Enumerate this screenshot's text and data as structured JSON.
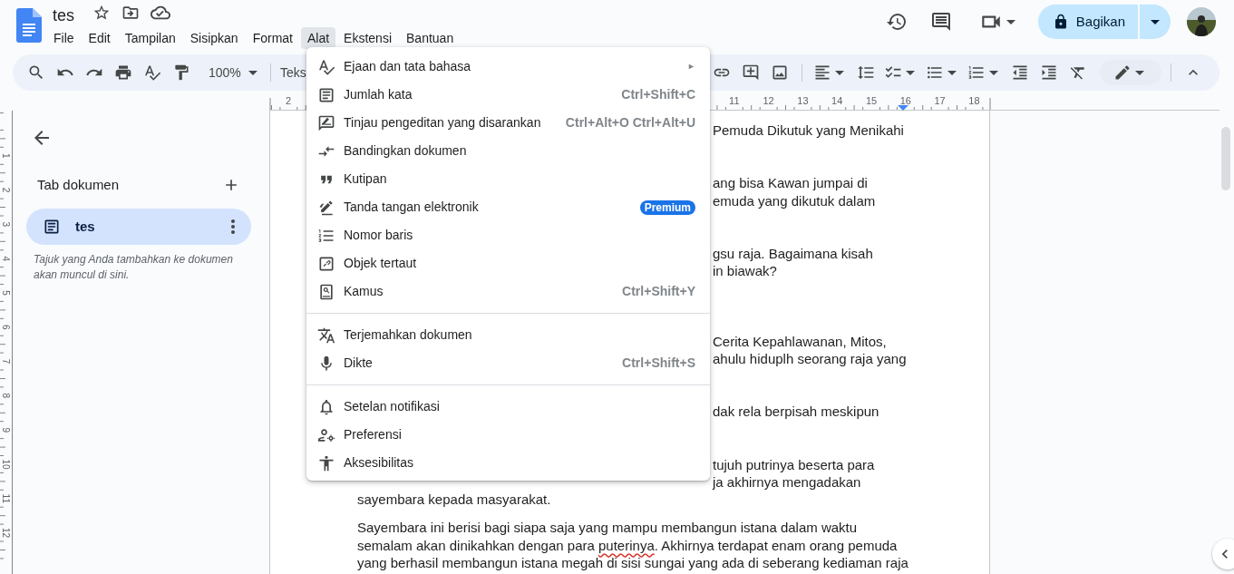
{
  "document": {
    "title": "tes"
  },
  "menubar": [
    {
      "label": "File",
      "selected": false
    },
    {
      "label": "Edit",
      "selected": false
    },
    {
      "label": "Tampilan",
      "selected": false
    },
    {
      "label": "Sisipkan",
      "selected": false
    },
    {
      "label": "Format",
      "selected": false
    },
    {
      "label": "Alat",
      "selected": true
    },
    {
      "label": "Ekstensi",
      "selected": false
    },
    {
      "label": "Bantuan",
      "selected": false
    }
  ],
  "share_button": {
    "label": "Bagikan"
  },
  "toolbar": {
    "zoom": "100%",
    "style": "Teks"
  },
  "ruler": {
    "labels": [
      "2",
      "11",
      "12",
      "13",
      "14",
      "15",
      "16",
      "17",
      "18"
    ]
  },
  "vertical_ruler": {
    "labels": [
      "1",
      "2",
      "3",
      "4",
      "5",
      "6",
      "7",
      "8",
      "9",
      "10",
      "11",
      "12"
    ]
  },
  "sidebar": {
    "heading": "Tab dokumen",
    "tabs": [
      {
        "label": "tes",
        "selected": true
      }
    ],
    "hint": "Tajuk yang Anda tambahkan ke dokumen akan muncul di sini."
  },
  "page": {
    "paragraphs": [
      {
        "lines": [
          {
            "kind": "covered",
            "text": "Pemuda Dikutuk yang Menikahi"
          }
        ]
      },
      {
        "lines": [
          {
            "kind": "covered",
            "text": "ang bisa Kawan jumpai di"
          },
          {
            "kind": "covered",
            "text": "emuda yang dikutuk dalam"
          }
        ]
      },
      {
        "lines": [
          {
            "kind": "covered",
            "text": "gsu raja. Bagaimana kisah"
          },
          {
            "kind": "covered",
            "text": "in biawak?"
          }
        ]
      },
      {
        "lines": [
          {
            "kind": "covered",
            "text": "Cerita Kepahlawanan, Mitos,"
          },
          {
            "kind": "covered",
            "text": "ahulu hiduplh seorang raja yang"
          }
        ]
      },
      {
        "lines": [
          {
            "kind": "covered",
            "text": "dak rela berpisah meskipun"
          }
        ]
      },
      {
        "lines": [
          {
            "kind": "covered",
            "text": "tujuh putrinya beserta para"
          },
          {
            "kind": "covered",
            "text": "ja akhirnya mengadakan"
          },
          {
            "kind": "full",
            "text": "sayembara kepada masyarakat."
          }
        ]
      },
      {
        "lines": [
          {
            "kind": "full",
            "text": "Sayembara ini berisi bagi siapa saja yang mampu membangun istana dalam waktu"
          },
          {
            "kind": "full",
            "segments": [
              {
                "text": "semalam akan dinikahkan dengan para ",
                "misspelled": false
              },
              {
                "text": "puterinya",
                "misspelled": true
              },
              {
                "text": ". Akhirnya terdapat enam orang pemuda",
                "misspelled": false
              }
            ]
          },
          {
            "kind": "full",
            "text": "yang berhasil membangun istana megah di sisi sungai yang ada di seberang kediaman raja"
          }
        ]
      }
    ]
  },
  "tools_menu": {
    "sections": [
      [
        {
          "label": "Ejaan dan tata bahasa",
          "submenu_arrow": "►"
        },
        {
          "label": "Jumlah kata",
          "shortcut": "Ctrl+Shift+C"
        },
        {
          "label": "Tinjau pengeditan yang disarankan",
          "shortcut": "Ctrl+Alt+O Ctrl+Alt+U"
        },
        {
          "label": "Bandingkan dokumen"
        },
        {
          "label": "Kutipan"
        },
        {
          "label": "Tanda tangan elektronik",
          "badge": "Premium"
        },
        {
          "label": "Nomor baris"
        },
        {
          "label": "Objek tertaut"
        },
        {
          "label": "Kamus",
          "shortcut": "Ctrl+Shift+Y"
        }
      ],
      [
        {
          "label": "Terjemahkan dokumen"
        },
        {
          "label": "Dikte",
          "shortcut": "Ctrl+Shift+S"
        }
      ],
      [
        {
          "label": "Setelan notifikasi"
        },
        {
          "label": "Preferensi"
        },
        {
          "label": "Aksesibilitas"
        }
      ]
    ]
  }
}
